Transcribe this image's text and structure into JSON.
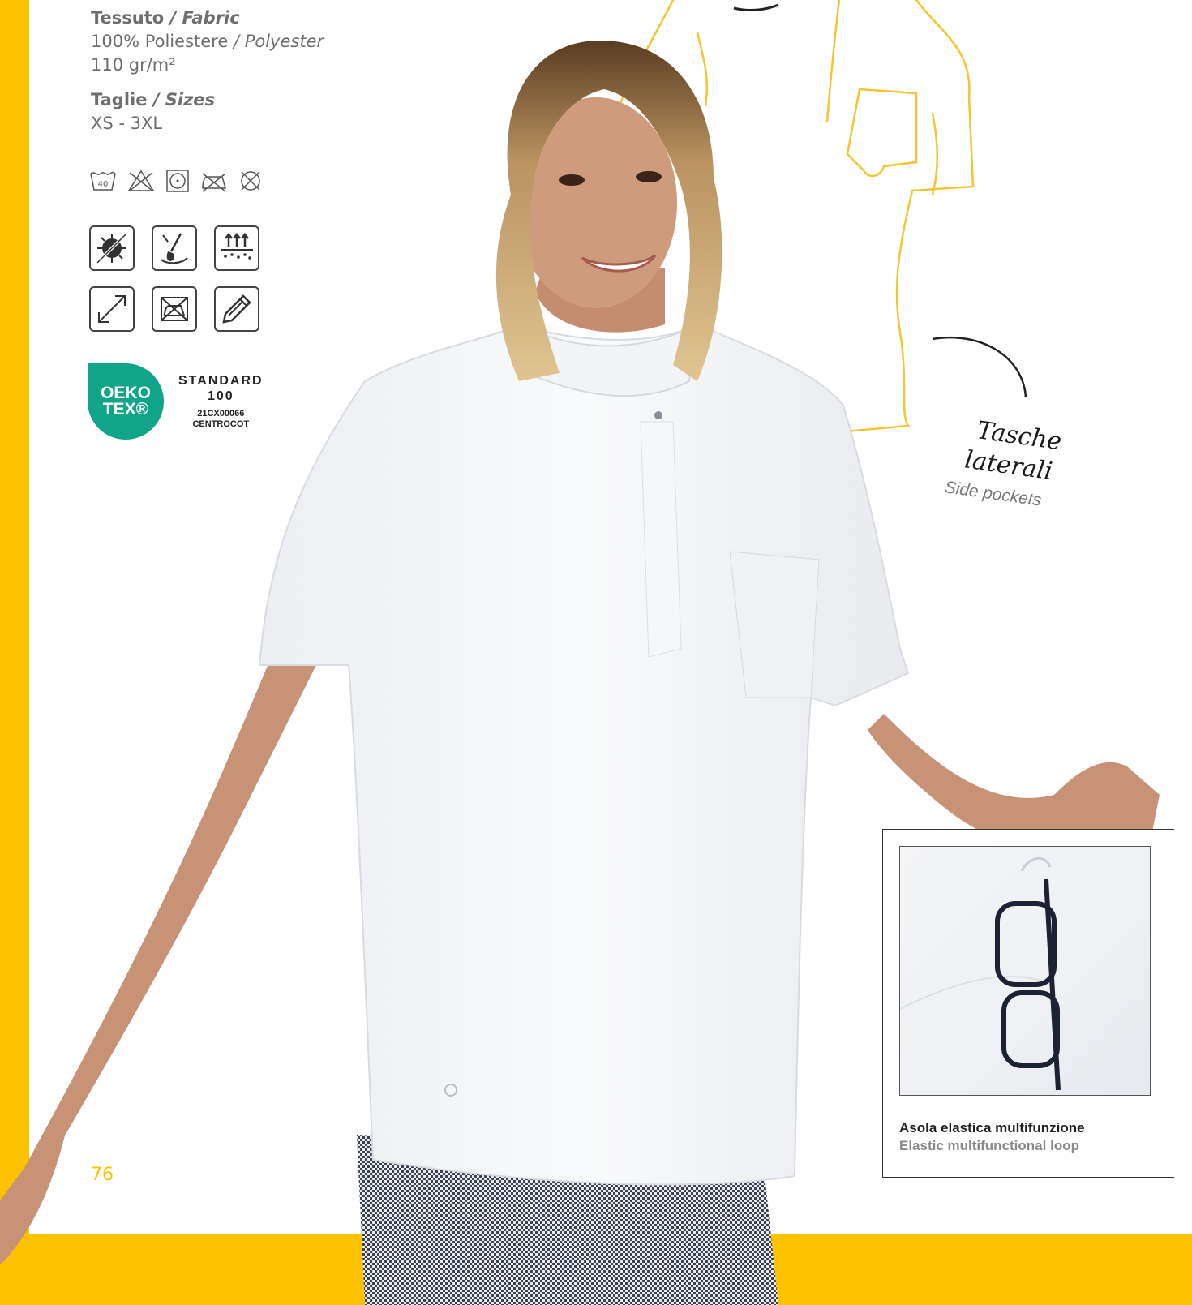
{
  "specs": {
    "fabric_label_it": "Tessuto",
    "fabric_label_en": " / Fabric",
    "fabric_comp_it": "100% Poliestere",
    "fabric_comp_en": " / Polyester",
    "fabric_weight": "110 gr/m²",
    "sizes_label_it": "Taglie",
    "sizes_label_en": " / Sizes",
    "sizes_value": "XS - 3XL"
  },
  "care_icons": [
    "wash-40-icon",
    "no-bleach-icon",
    "tumble-dry-icon",
    "no-iron-icon",
    "no-dryclean-icon"
  ],
  "care_wash_temp": "40",
  "feature_icons": [
    "antibacterial-icon",
    "stain-resistant-icon",
    "breathable-icon",
    "stretch-icon",
    "no-iron-feature-icon",
    "customizable-icon"
  ],
  "oeko": {
    "brand_line1": "OEKO",
    "brand_line2": "TEX®",
    "standard": "STANDARD",
    "number": "100",
    "code": "21CX00066",
    "institute": "CENTROCOT"
  },
  "callout": {
    "it_line1": "Tasche",
    "it_line2": "laterali",
    "en": "Side pockets"
  },
  "detail": {
    "caption_it": "Asola elastica multifunzione",
    "caption_en": "Elastic multifunctional loop"
  },
  "page_number": "76",
  "colors": {
    "accent": "#fdc300",
    "oeko_green": "#10a589"
  }
}
